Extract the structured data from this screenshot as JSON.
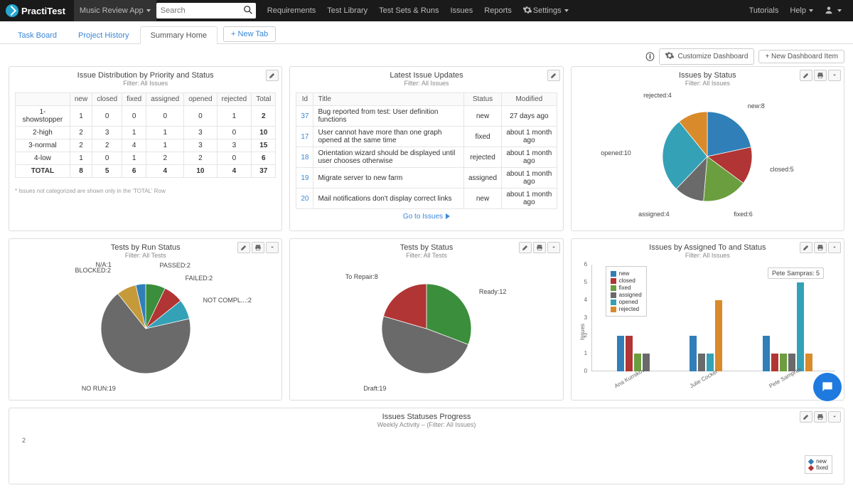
{
  "brand": "PractiTest",
  "app_name": "Music Review App",
  "search_placeholder": "Search",
  "top_nav": [
    "Requirements",
    "Test Library",
    "Test Sets & Runs",
    "Issues",
    "Reports"
  ],
  "settings_label": "Settings",
  "tutorials_label": "Tutorials",
  "help_label": "Help",
  "subtabs": {
    "items": [
      "Task Board",
      "Project History",
      "Summary Home"
    ],
    "active_index": 2,
    "new_tab_label": "+ New Tab"
  },
  "toolbar": {
    "customize": "Customize Dashboard",
    "new_item": "+ New Dashboard Item"
  },
  "panels": {
    "dist": {
      "title": "Issue Distribution by Priority and Status",
      "subtitle": "Filter: All Issues",
      "columns": [
        "",
        "new",
        "closed",
        "fixed",
        "assigned",
        "opened",
        "rejected",
        "Total"
      ],
      "rows": [
        {
          "label": "1-showstopper",
          "vals": [
            1,
            0,
            0,
            0,
            0,
            1,
            2
          ]
        },
        {
          "label": "2-high",
          "vals": [
            2,
            3,
            1,
            1,
            3,
            0,
            10
          ]
        },
        {
          "label": "3-normal",
          "vals": [
            2,
            2,
            4,
            1,
            3,
            3,
            15
          ]
        },
        {
          "label": "4-low",
          "vals": [
            1,
            0,
            1,
            2,
            2,
            0,
            6
          ]
        },
        {
          "label": "TOTAL",
          "vals": [
            8,
            5,
            6,
            4,
            10,
            4,
            37
          ]
        }
      ],
      "footnote": "* Issues not categorized are shown only in the 'TOTAL' Row"
    },
    "latest": {
      "title": "Latest Issue Updates",
      "subtitle": "Filter: All Issues",
      "columns": [
        "Id",
        "Title",
        "Status",
        "Modified"
      ],
      "rows": [
        {
          "id": 37,
          "title": "Bug reported from test: User definition functions",
          "status": "new",
          "modified": "27 days ago"
        },
        {
          "id": 17,
          "title": "User cannot have more than one graph opened at the same time",
          "status": "fixed",
          "modified": "about 1 month ago"
        },
        {
          "id": 18,
          "title": "Orientation wizard should be displayed until user chooses otherwise",
          "status": "rejected",
          "modified": "about 1 month ago"
        },
        {
          "id": 19,
          "title": "Migrate server to new farm",
          "status": "assigned",
          "modified": "about 1 month ago"
        },
        {
          "id": 20,
          "title": "Mail notifications don't display correct links",
          "status": "new",
          "modified": "about 1 month ago"
        }
      ],
      "goto": "Go to Issues"
    },
    "issues_by_status": {
      "title": "Issues by Status",
      "subtitle": "Filter: All Issues"
    },
    "tests_by_run": {
      "title": "Tests by Run Status",
      "subtitle": "Filter: All Tests"
    },
    "tests_by_status": {
      "title": "Tests by Status",
      "subtitle": "Filter: All Tests"
    },
    "issues_by_assignee": {
      "title": "Issues by Assigned To and Status",
      "subtitle": "Filter: All Issues",
      "ylabel": "Issues",
      "tooltip": "Pete Sampras: 5"
    },
    "progress": {
      "title": "Issues Statuses Progress",
      "subtitle": "Weekly Activity – (Filter: All Issues)"
    }
  },
  "chart_data": [
    {
      "id": "issues_by_status",
      "type": "pie",
      "title": "Issues by Status",
      "series": [
        {
          "name": "new",
          "value": 8
        },
        {
          "name": "closed",
          "value": 5
        },
        {
          "name": "fixed",
          "value": 6
        },
        {
          "name": "assigned",
          "value": 4
        },
        {
          "name": "opened",
          "value": 10
        },
        {
          "name": "rejected",
          "value": 4
        }
      ],
      "colors": {
        "new": "#307fb8",
        "closed": "#b03534",
        "fixed": "#6b9e3f",
        "assigned": "#6a6a6a",
        "opened": "#34a1b6",
        "rejected": "#d98a2b"
      }
    },
    {
      "id": "tests_by_run",
      "type": "pie",
      "title": "Tests by Run Status",
      "series": [
        {
          "name": "PASSED",
          "value": 2
        },
        {
          "name": "FAILED",
          "value": 2
        },
        {
          "name": "NOT COMPL...",
          "value": 2
        },
        {
          "name": "NO RUN",
          "value": 19
        },
        {
          "name": "BLOCKED",
          "value": 2
        },
        {
          "name": "N/A",
          "value": 1
        }
      ],
      "colors": {
        "PASSED": "#3b8e3b",
        "FAILED": "#b03534",
        "NOT COMPL...": "#34a1b6",
        "NO RUN": "#6a6a6a",
        "BLOCKED": "#c59a3a",
        "N/A": "#307fb8"
      }
    },
    {
      "id": "tests_by_status",
      "type": "pie",
      "title": "Tests by Status",
      "series": [
        {
          "name": "Ready",
          "value": 12
        },
        {
          "name": "Draft",
          "value": 19
        },
        {
          "name": "To Repair",
          "value": 8
        }
      ],
      "colors": {
        "Ready": "#3b8e3b",
        "Draft": "#6a6a6a",
        "To Repair": "#b03534"
      }
    },
    {
      "id": "issues_by_assignee",
      "type": "bar",
      "title": "Issues by Assigned To and Status",
      "categories": [
        "Ana Kurnikova",
        "Julie Cocker",
        "Pete Sampras"
      ],
      "series": [
        {
          "name": "new",
          "color": "#307fb8",
          "values": [
            2,
            2,
            2
          ]
        },
        {
          "name": "closed",
          "color": "#b03534",
          "values": [
            2,
            0,
            1
          ]
        },
        {
          "name": "fixed",
          "color": "#6b9e3f",
          "values": [
            1,
            0,
            1
          ]
        },
        {
          "name": "assigned",
          "color": "#6a6a6a",
          "values": [
            1,
            1,
            1
          ]
        },
        {
          "name": "opened",
          "color": "#34a1b6",
          "values": [
            0,
            1,
            5
          ]
        },
        {
          "name": "rejected",
          "color": "#d98a2b",
          "values": [
            0,
            4,
            1
          ]
        }
      ],
      "ylim": [
        0,
        6
      ],
      "ylabel": "Issues"
    },
    {
      "id": "progress",
      "type": "line",
      "title": "Issues Statuses Progress",
      "series_names": [
        "new",
        "fixed"
      ],
      "colors": {
        "new": "#307fb8",
        "fixed": "#b03534"
      },
      "ytick_visible": 2
    }
  ]
}
